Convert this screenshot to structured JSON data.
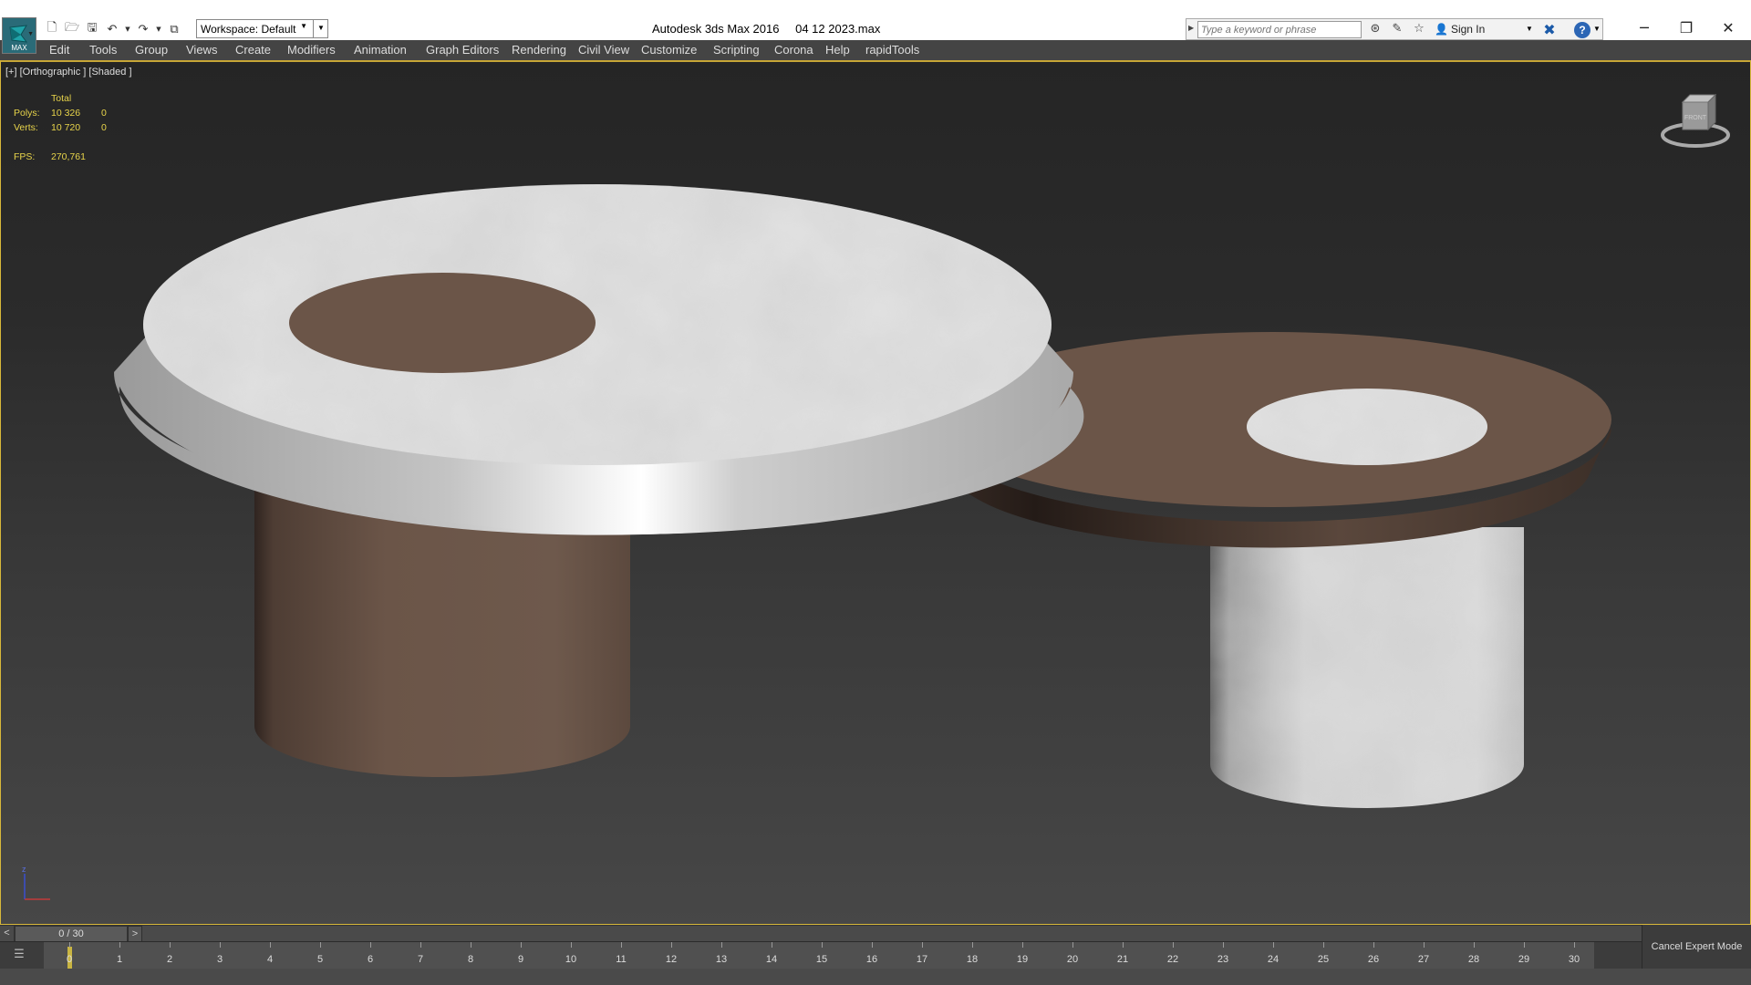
{
  "titlebar": {
    "app_label": "MAX",
    "workspace": "Workspace: Default",
    "app_name": "Autodesk 3ds Max 2016",
    "file_name": "04 12 2023.max",
    "search_placeholder": "Type a keyword or phrase",
    "sign_in": "Sign In",
    "help_glyph": "?"
  },
  "menu": [
    "Edit",
    "Tools",
    "Group",
    "Views",
    "Create",
    "Modifiers",
    "Animation",
    "Graph Editors",
    "Rendering",
    "Civil View",
    "Customize",
    "Scripting",
    "Corona",
    "Help",
    "rapidTools"
  ],
  "viewport": {
    "label": "[+] [Orthographic ] [Shaded ]",
    "stats": {
      "total_label": "Total",
      "polys_label": "Polys:",
      "polys_total": "10 326",
      "polys_sel": "0",
      "verts_label": "Verts:",
      "verts_total": "10 720",
      "verts_sel": "0",
      "fps_label": "FPS:",
      "fps_value": "270,761"
    },
    "axis_label": "z"
  },
  "timeline": {
    "prev": "<",
    "next": ">",
    "frame_display": "0 / 30",
    "ticks": [
      "0",
      "1",
      "2",
      "3",
      "4",
      "5",
      "6",
      "7",
      "8",
      "9",
      "10",
      "11",
      "12",
      "13",
      "14",
      "15",
      "16",
      "17",
      "18",
      "19",
      "20",
      "21",
      "22",
      "23",
      "24",
      "25",
      "26",
      "27",
      "28",
      "29",
      "30"
    ]
  },
  "cancel_expert": "Cancel Expert Mode",
  "colors": {
    "viewport_border": "#d8b83a",
    "marble": "#d9d9d9",
    "wood": "#6b5548",
    "stats_text": "#e8d44a"
  }
}
